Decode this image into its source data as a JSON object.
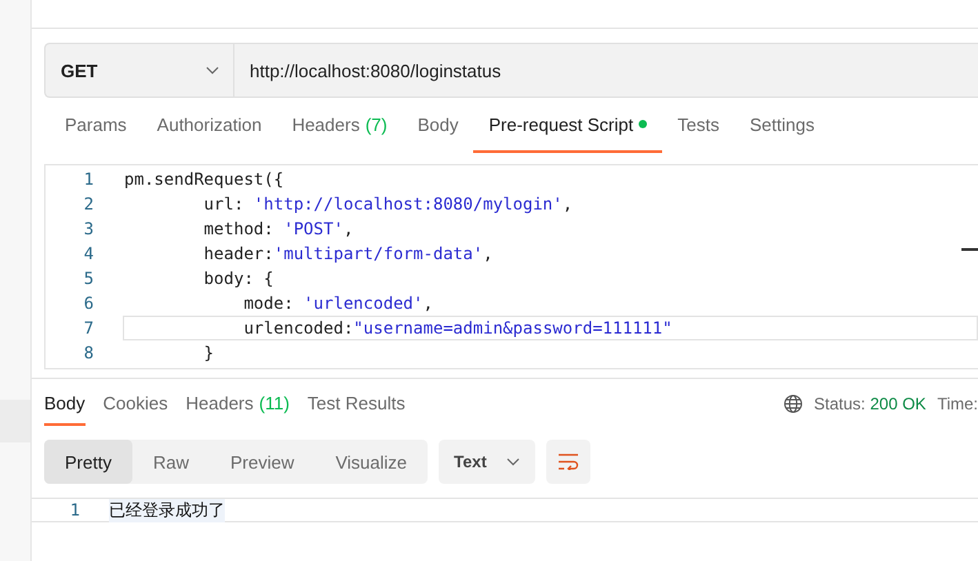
{
  "request": {
    "method": "GET",
    "url": "http://localhost:8080/loginstatus"
  },
  "request_tabs": [
    {
      "label": "Params",
      "dot": false,
      "selected": false
    },
    {
      "label": "Authorization",
      "dot": false,
      "selected": false
    },
    {
      "label": "Headers",
      "count": "(7)",
      "dot": false,
      "selected": false
    },
    {
      "label": "Body",
      "dot": false,
      "selected": false
    },
    {
      "label": "Pre-request Script",
      "dot": true,
      "selected": true
    },
    {
      "label": "Tests",
      "dot": false,
      "selected": false
    },
    {
      "label": "Settings",
      "dot": false,
      "selected": false
    }
  ],
  "script_lines": [
    {
      "number": "1",
      "active": false,
      "tokens": [
        {
          "kind": "plain",
          "text": "pm.sendRequest({"
        }
      ]
    },
    {
      "number": "2",
      "active": false,
      "tokens": [
        {
          "kind": "plain",
          "text": "        url: "
        },
        {
          "kind": "string",
          "text": "'http://localhost:8080/mylogin'"
        },
        {
          "kind": "plain",
          "text": ","
        }
      ]
    },
    {
      "number": "3",
      "active": false,
      "tokens": [
        {
          "kind": "plain",
          "text": "        method: "
        },
        {
          "kind": "string",
          "text": "'POST'"
        },
        {
          "kind": "plain",
          "text": ","
        }
      ]
    },
    {
      "number": "4",
      "active": false,
      "tokens": [
        {
          "kind": "plain",
          "text": "        header:"
        },
        {
          "kind": "string",
          "text": "'multipart/form-data'"
        },
        {
          "kind": "plain",
          "text": ","
        }
      ]
    },
    {
      "number": "5",
      "active": false,
      "tokens": [
        {
          "kind": "plain",
          "text": "        body: {"
        }
      ]
    },
    {
      "number": "6",
      "active": false,
      "tokens": [
        {
          "kind": "plain",
          "text": "            mode: "
        },
        {
          "kind": "string",
          "text": "'urlencoded'"
        },
        {
          "kind": "plain",
          "text": ","
        }
      ]
    },
    {
      "number": "7",
      "active": true,
      "tokens": [
        {
          "kind": "plain",
          "text": "            urlencoded:"
        },
        {
          "kind": "string",
          "text": "\"username=admin&password=111111\""
        }
      ]
    },
    {
      "number": "8",
      "active": false,
      "tokens": [
        {
          "kind": "plain",
          "text": "        }"
        }
      ]
    }
  ],
  "response_tabs": [
    {
      "label": "Body",
      "selected": true
    },
    {
      "label": "Cookies",
      "selected": false
    },
    {
      "label": "Headers",
      "count": "(11)",
      "selected": false
    },
    {
      "label": "Test Results",
      "selected": false
    }
  ],
  "status": {
    "label": "Status:",
    "value": "200 OK",
    "time_label": "Time:"
  },
  "view_modes": [
    {
      "label": "Pretty",
      "selected": true
    },
    {
      "label": "Raw",
      "selected": false
    },
    {
      "label": "Preview",
      "selected": false
    },
    {
      "label": "Visualize",
      "selected": false
    }
  ],
  "format": "Text",
  "output_lines": [
    {
      "number": "1",
      "text": "已经登录成功了"
    }
  ]
}
